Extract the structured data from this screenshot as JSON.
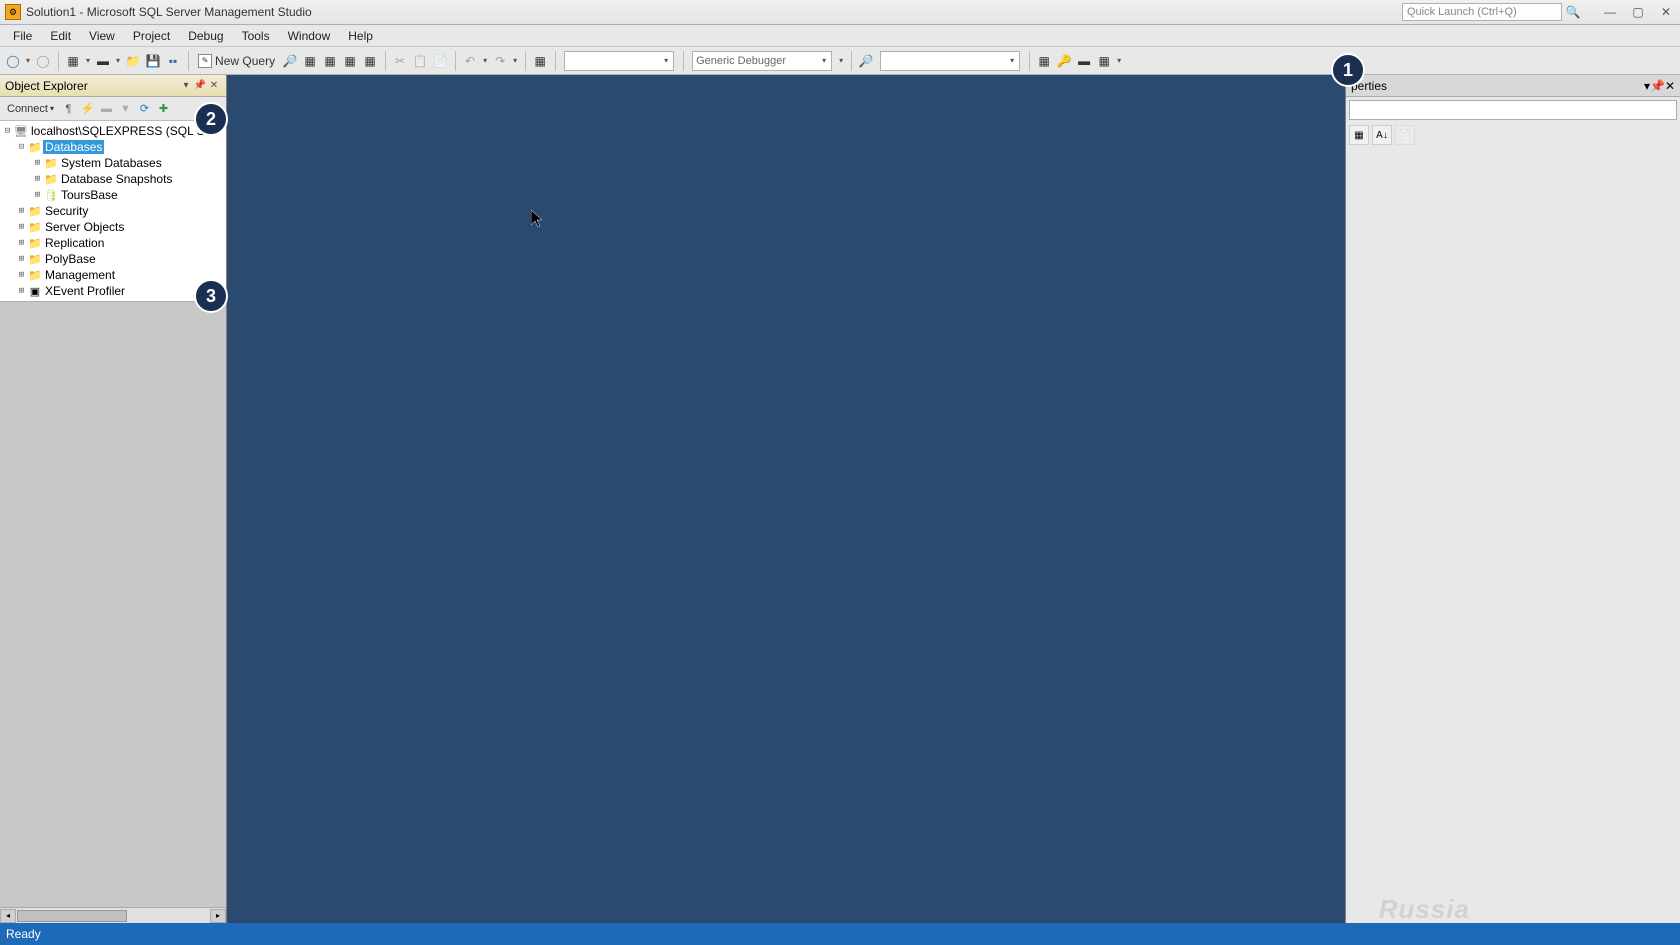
{
  "title": "Solution1 - Microsoft SQL Server Management Studio",
  "quick_launch_placeholder": "Quick Launch (Ctrl+Q)",
  "menus": {
    "file": "File",
    "edit": "Edit",
    "view": "View",
    "project": "Project",
    "debug": "Debug",
    "tools": "Tools",
    "window": "Window",
    "help": "Help"
  },
  "toolbar": {
    "new_query": "New Query",
    "debugger_combo": "Generic Debugger"
  },
  "explorer": {
    "title": "Object Explorer",
    "connect": "Connect",
    "server": "localhost\\SQLEXPRESS (SQL S",
    "tree": {
      "databases": "Databases",
      "sysdb": "System Databases",
      "snapshots": "Database Snapshots",
      "toursbase": "ToursBase",
      "security": "Security",
      "serverobj": "Server Objects",
      "replication": "Replication",
      "polybase": "PolyBase",
      "management": "Management",
      "xevent": "XEvent Profiler"
    }
  },
  "properties": {
    "title": "perties"
  },
  "status": "Ready",
  "badges": {
    "b1": "1",
    "b2": "2",
    "b3": "3"
  },
  "watermark": "Russia"
}
